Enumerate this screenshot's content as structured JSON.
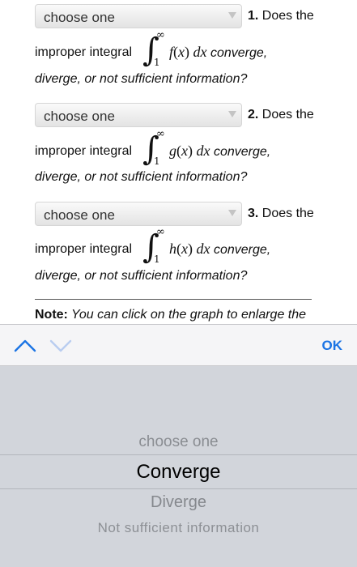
{
  "questions": [
    {
      "select_value": "choose one",
      "number": "1.",
      "prompt_start": " Does the",
      "lead": "improper integral",
      "upper": "∞",
      "lower": "1",
      "func": "f",
      "var": "x",
      "dx": "dx",
      "trail": " converge,",
      "line3": "diverge, or not sufficient information?"
    },
    {
      "select_value": "choose one",
      "number": "2.",
      "prompt_start": " Does the",
      "lead": "improper integral",
      "upper": "∞",
      "lower": "1",
      "func": "g",
      "var": "x",
      "dx": "dx",
      "trail": " converge,",
      "line3": "diverge, or not sufficient information?"
    },
    {
      "select_value": "choose one",
      "number": "3.",
      "prompt_start": " Does the",
      "lead": "improper integral",
      "upper": "∞",
      "lower": "1",
      "func": "h",
      "var": "x",
      "dx": "dx",
      "trail": " converge,",
      "line3": "diverge, or not sufficient information?"
    }
  ],
  "note": {
    "label": "Note:",
    "text": " You can click on the graph to enlarge the"
  },
  "accessory": {
    "prev_icon": "chevron-up-icon",
    "next_icon": "chevron-down-icon",
    "ok_label": "OK",
    "accent": "#1b74e4"
  },
  "picker": {
    "options": [
      "choose one",
      "Converge",
      "Diverge",
      "Not sufficient information"
    ],
    "selected": "Converge"
  }
}
